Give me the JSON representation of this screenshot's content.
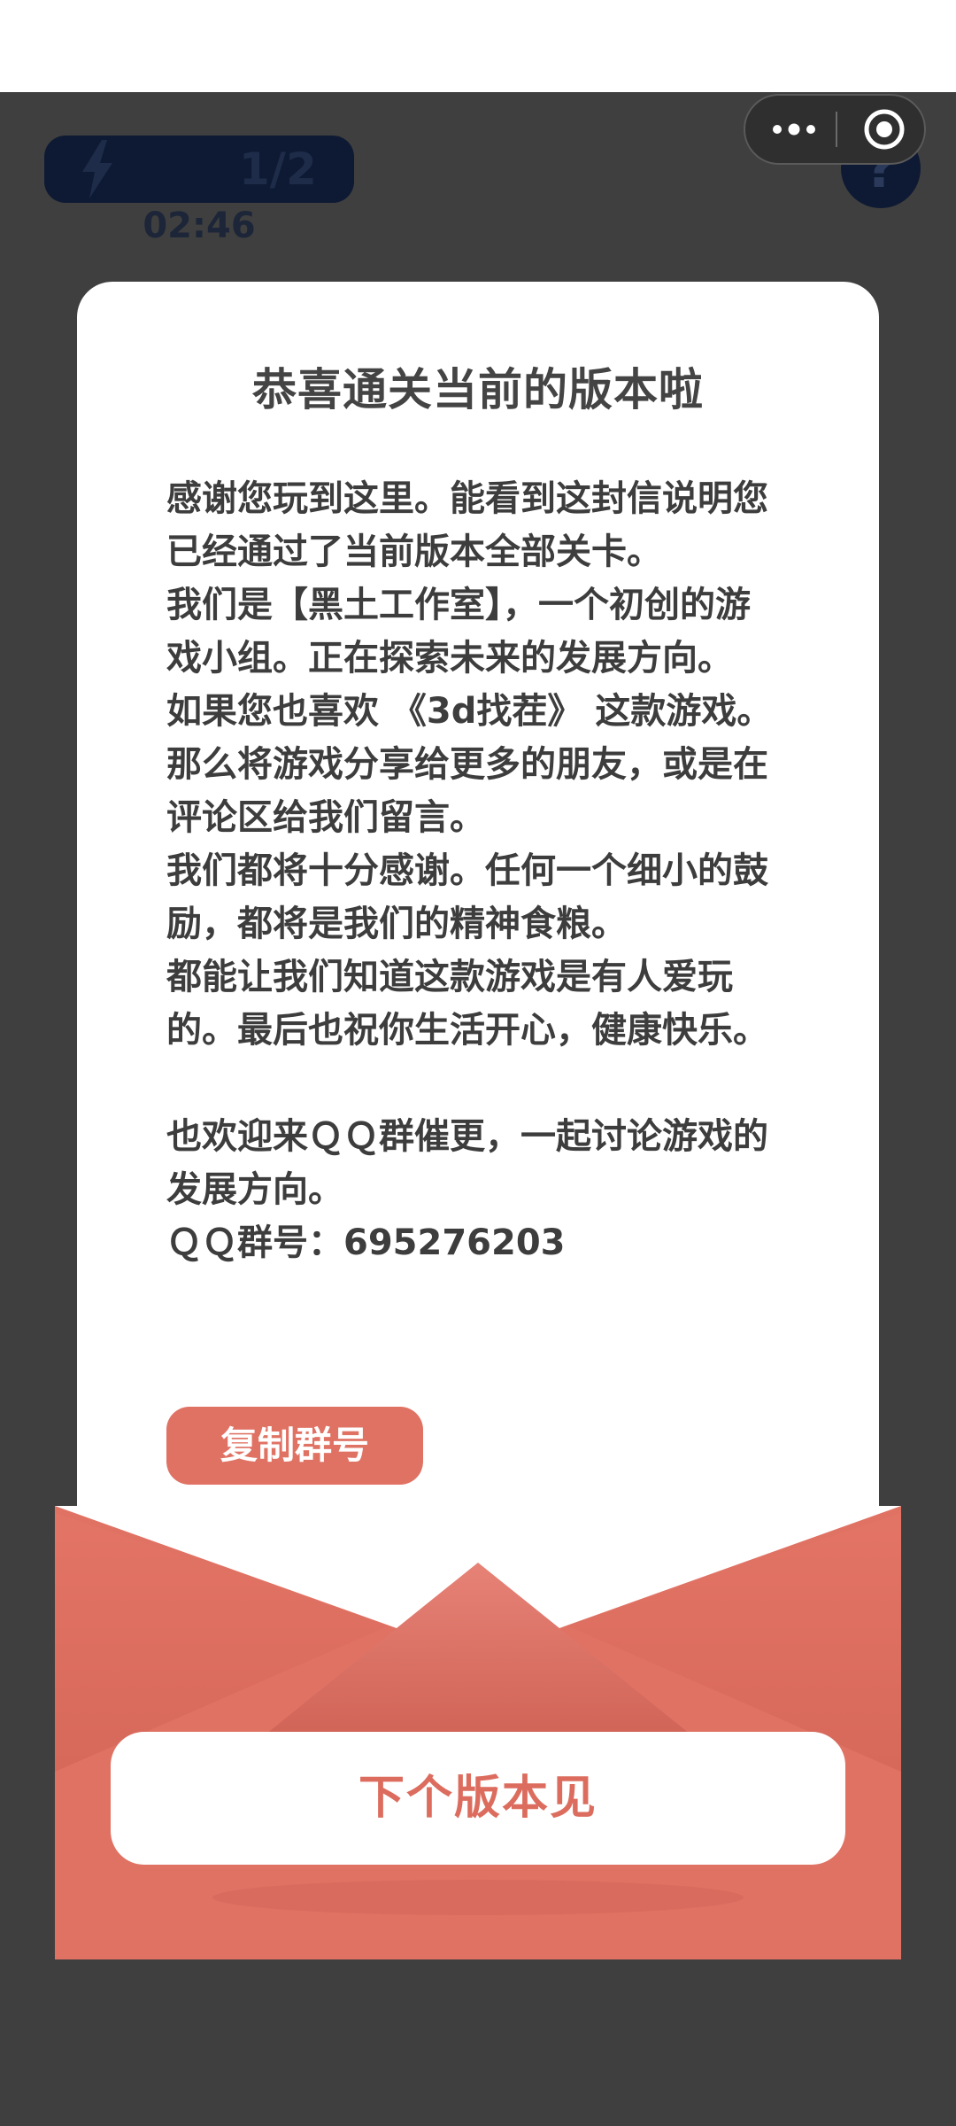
{
  "hud": {
    "level_progress": "1/2",
    "timer": "02:46",
    "help_symbol": "?"
  },
  "capsule": {
    "more_icon": "more-dots-icon",
    "close_icon": "target-circle-icon"
  },
  "letter": {
    "title": "恭喜通关当前的版本啦",
    "paragraphs": [
      "感谢您玩到这里。能看到这封信说明您已经通过了当前版本全部关卡。",
      "我们是【黑土工作室】，一个初创的游戏小组。正在探索未来的发展方向。",
      "如果您也喜欢 《3d找茬》 这款游戏。那么将游戏分享给更多的朋友，或是在评论区给我们留言。",
      "我们都将十分感谢。任何一个细小的鼓励，都将是我们的精神食粮。",
      "都能让我们知道这款游戏是有人爱玩的。最后也祝你生活开心，健康快乐。"
    ],
    "invite": "也欢迎来ＱＱ群催更，一起讨论游戏的发展方向。",
    "qq_group": "ＱＱ群号：695276203",
    "copy_button_label": "复制群号"
  },
  "envelope": {
    "next_button_label": "下个版本见"
  },
  "colors": {
    "accent": "#e07264",
    "overlay_bg": "#3f3f3f",
    "card_bg": "#ffffff",
    "text": "#3d3d3d"
  }
}
